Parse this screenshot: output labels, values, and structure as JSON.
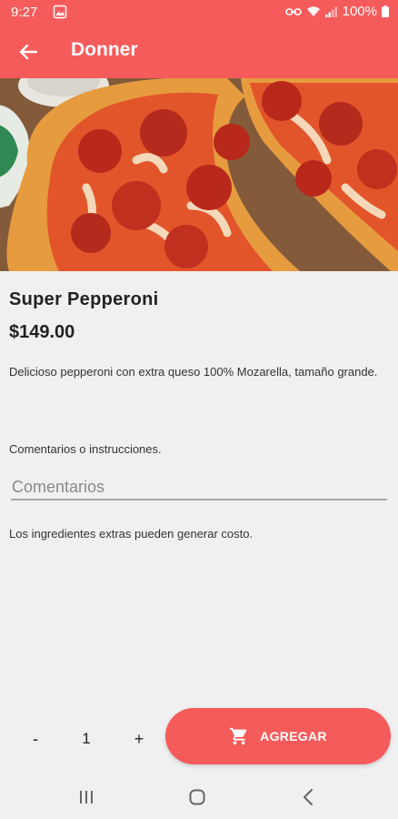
{
  "status_bar": {
    "time": "9:27",
    "battery": "100%"
  },
  "app_bar": {
    "title": "Donner"
  },
  "product": {
    "name": "Super Pepperoni",
    "price": "$149.00",
    "description": "Delicioso pepperoni con extra queso 100% Mozarella, tamaño grande."
  },
  "comments": {
    "label": "Comentarios o instrucciones.",
    "placeholder": "Comentarios",
    "value": ""
  },
  "extras_note": "Los ingredientes extras pueden generar costo.",
  "quantity": {
    "minus": "-",
    "value": "1",
    "plus": "+"
  },
  "add_button": {
    "label": "AGREGAR",
    "icon": "cart-icon"
  },
  "colors": {
    "accent": "#f65b5b",
    "background": "#f0f0f0",
    "text": "#222222"
  }
}
